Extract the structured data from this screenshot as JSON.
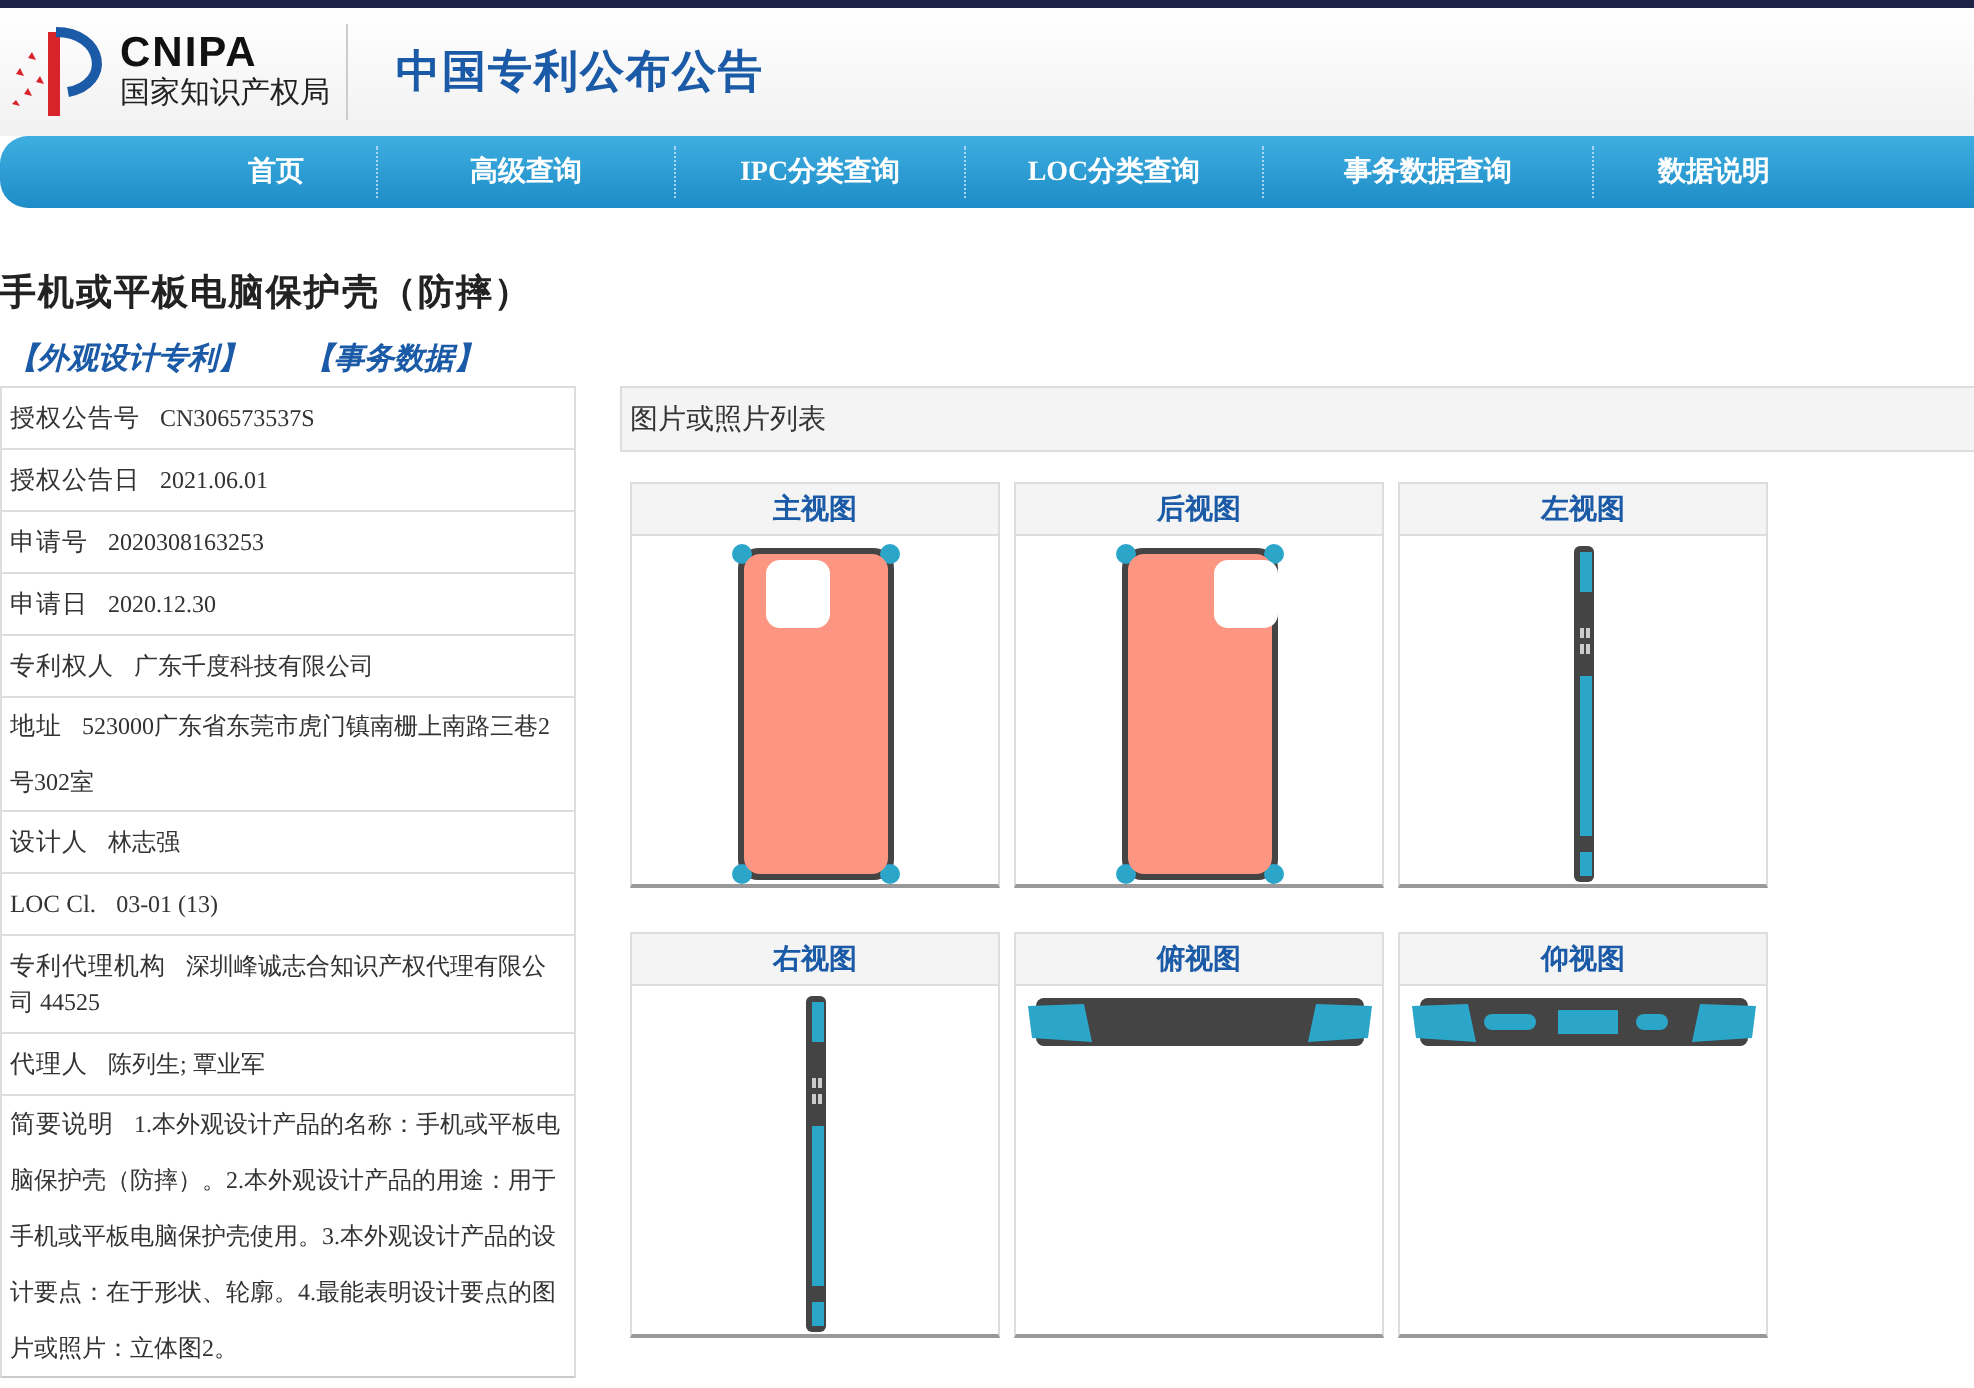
{
  "header": {
    "logo_text": "CNIPA",
    "logo_subtitle": "国家知识产权局",
    "site_title": "中国专利公布公告"
  },
  "nav": [
    {
      "label": "首页"
    },
    {
      "label": "高级查询"
    },
    {
      "label": "IPC分类查询"
    },
    {
      "label": "LOC分类查询"
    },
    {
      "label": "事务数据查询"
    },
    {
      "label": "数据说明"
    }
  ],
  "title": "手机或平板电脑保护壳（防摔）",
  "links": [
    {
      "label": "【外观设计专利】"
    },
    {
      "label": "【事务数据】"
    }
  ],
  "fields": [
    {
      "label": "授权公告号",
      "value": "CN306573537S"
    },
    {
      "label": "授权公告日",
      "value": "2021.06.01"
    },
    {
      "label": "申请号",
      "value": "2020308163253"
    },
    {
      "label": "申请日",
      "value": "2020.12.30"
    },
    {
      "label": "专利权人",
      "value": "广东千度科技有限公司"
    },
    {
      "label": "地址",
      "value": "523000广东省东莞市虎门镇南栅上南路三巷2号302室"
    },
    {
      "label": "设计人",
      "value": "林志强"
    },
    {
      "label": "LOC Cl.",
      "value": "03-01 (13)"
    },
    {
      "label": "专利代理机构",
      "value": "深圳峰诚志合知识产权代理有限公司 44525"
    },
    {
      "label": "代理人",
      "value": "陈列生; 覃业军"
    },
    {
      "label": "简要说明",
      "value": "1.本外观设计产品的名称：手机或平板电脑保护壳（防摔）。2.本外观设计产品的用途：用于手机或平板电脑保护壳使用。3.本外观设计产品的设计要点：在于形状、轮廓。4.最能表明设计要点的图片或照片：立体图2。"
    }
  ],
  "gallery": {
    "title": "图片或照片列表",
    "views": [
      {
        "caption": "主视图",
        "kind": "front"
      },
      {
        "caption": "后视图",
        "kind": "back"
      },
      {
        "caption": "左视图",
        "kind": "left"
      },
      {
        "caption": "右视图",
        "kind": "right"
      },
      {
        "caption": "俯视图",
        "kind": "top"
      },
      {
        "caption": "仰视图",
        "kind": "bottom"
      }
    ]
  }
}
